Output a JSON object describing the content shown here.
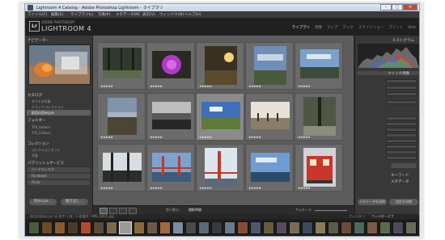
{
  "window": {
    "title": "Lightroom 4 Catalog - Adobe Photoshop Lightroom - ライブラリ",
    "min": "–",
    "max": "□",
    "close": "✕"
  },
  "menu": [
    "ファイル(F)",
    "編集(E)",
    "ライブラリ(L)",
    "写真(P)",
    "メタデータ(M)",
    "表示(V)",
    "ウィンドウ(W)",
    "ヘルプ(H)"
  ],
  "branding": {
    "badge": "Lr",
    "sub": "ADOBE PHOTOSHOP",
    "product": "LIGHTROOM 4"
  },
  "modules": [
    "ライブラリ",
    "現像",
    "マップ",
    "ブック",
    "スライドショー",
    "プリント",
    "Web"
  ],
  "left_panel": {
    "navigator": "ナビゲーター",
    "catalog": "カタログ",
    "catalog_items": [
      "すべての写真",
      "クイックコレクション",
      "前回の読み込み"
    ],
    "folders": "フォルダー",
    "folder_items": [
      "TFS_folders",
      "TFS_Folders"
    ],
    "collections": "コレクション",
    "collection_items": [
      "コレクションセット",
      "写真"
    ],
    "publish": "パブリッシュサービス",
    "publish_items": [
      "ハードディスク",
      "Facebook",
      "Flickr"
    ],
    "import_button": "読み込み...",
    "export_button": "書き出し..."
  },
  "right_panel": {
    "histogram": "ヒストグラム",
    "quick_develop": "クイック現像",
    "keywording": "キーワード",
    "metadata": "メタデータ",
    "sync_meta": "メタデータを同期",
    "sync_settings": "設定を同期"
  },
  "grid": {
    "stars": "★★★★★",
    "colors": {
      "selected_cell": "#8a8a8a",
      "cell": "#6b6b6b"
    }
  },
  "toolbar": {
    "sort_label": "並べ替え：",
    "sort_value": "撮影時間",
    "thumbs": "サムネール"
  },
  "filmstrip": {
    "path": "前回の読み込み  52 枚中 1 枚 / 1 枚選択 / IMG_0001.jpg",
    "filter": "フィルター：",
    "filter_value": "フィルターオフ"
  }
}
